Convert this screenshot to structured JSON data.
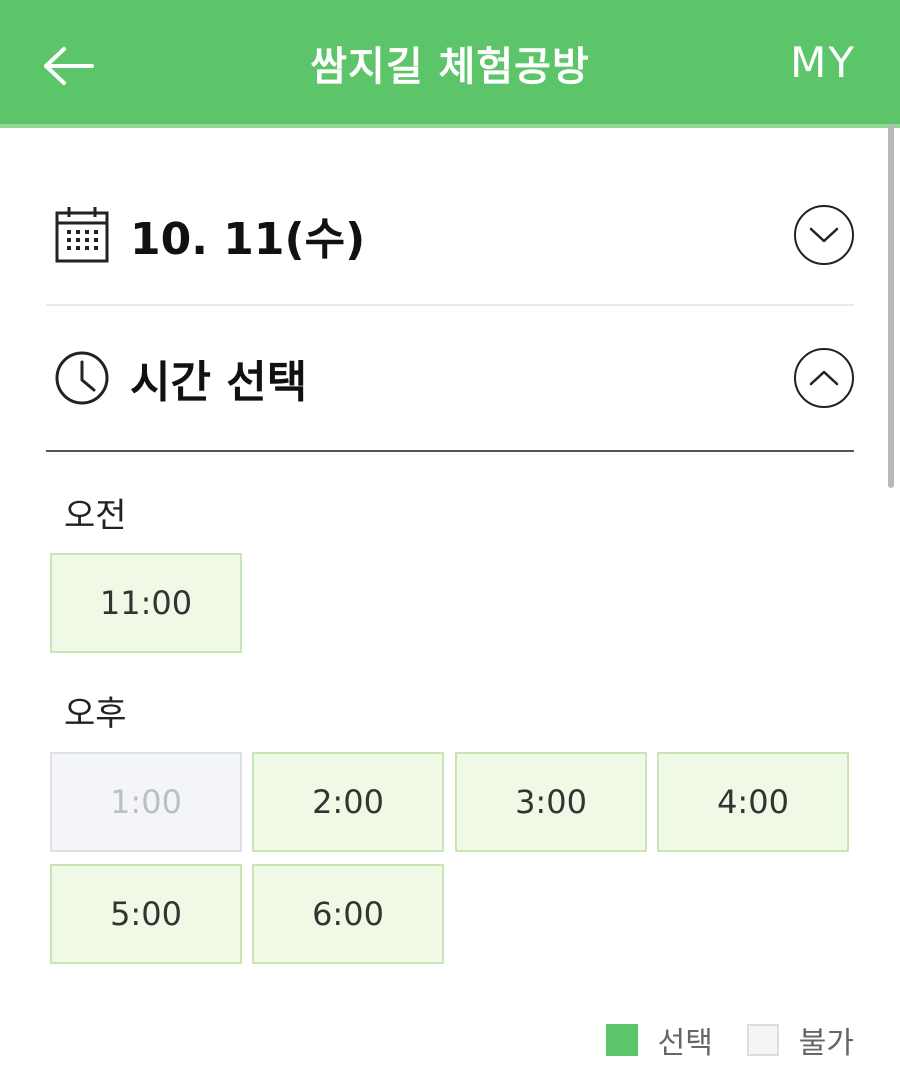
{
  "header": {
    "back_icon": "arrow-left-icon",
    "title": "쌈지길 체험공방",
    "my_label": "MY",
    "color": "#5cc469"
  },
  "date_section": {
    "icon": "calendar-icon",
    "label": "10. 11(수)",
    "toggle_icon": "chevron-down-icon"
  },
  "time_section": {
    "icon": "clock-icon",
    "label": "시간 선택",
    "toggle_icon": "chevron-up-icon"
  },
  "am": {
    "label": "오전",
    "slots": [
      {
        "time": "11:00",
        "available": true
      }
    ]
  },
  "pm": {
    "label": "오후",
    "slots": [
      {
        "time": "1:00",
        "available": false
      },
      {
        "time": "2:00",
        "available": true
      },
      {
        "time": "3:00",
        "available": true
      },
      {
        "time": "4:00",
        "available": true
      },
      {
        "time": "5:00",
        "available": true
      },
      {
        "time": "6:00",
        "available": true
      }
    ]
  },
  "legend": {
    "selected_label": "선택",
    "unavailable_label": "불가",
    "selected_color": "#5cc469",
    "unavailable_color": "#f5f5f5"
  }
}
